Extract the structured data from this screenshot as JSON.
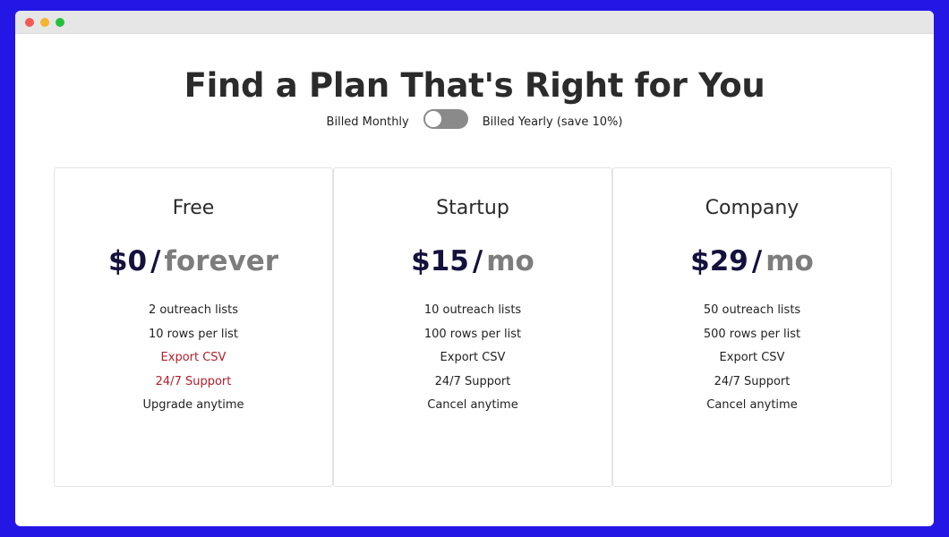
{
  "colors": {
    "background": "#2417e6",
    "window_dot_red": "#f25a55",
    "window_dot_yellow": "#f6b42b",
    "window_dot_green": "#26c03c",
    "price_amount": "#14113d",
    "price_period": "#7d7d7d",
    "unavailable_feature": "#b31d2a",
    "toggle_track": "#8a8a8a"
  },
  "heading": "Find a Plan That's Right for You",
  "billing": {
    "monthly_label": "Billed Monthly",
    "yearly_label": "Billed Yearly (save 10%)",
    "toggle_on": false
  },
  "plans": [
    {
      "name": "Free",
      "amount": "$0",
      "slash": "/",
      "period": "forever",
      "features": [
        {
          "text": "2 outreach lists",
          "available": true
        },
        {
          "text": "10 rows per list",
          "available": true
        },
        {
          "text": "Export CSV",
          "available": false
        },
        {
          "text": "24/7 Support",
          "available": false
        },
        {
          "text": "Upgrade anytime",
          "available": true
        }
      ]
    },
    {
      "name": "Startup",
      "amount": "$15",
      "slash": "/",
      "period": "mo",
      "features": [
        {
          "text": "10 outreach lists",
          "available": true
        },
        {
          "text": "100 rows per list",
          "available": true
        },
        {
          "text": "Export CSV",
          "available": true
        },
        {
          "text": "24/7 Support",
          "available": true
        },
        {
          "text": "Cancel anytime",
          "available": true
        }
      ]
    },
    {
      "name": "Company",
      "amount": "$29",
      "slash": "/",
      "period": "mo",
      "features": [
        {
          "text": "50 outreach lists",
          "available": true
        },
        {
          "text": "500 rows per list",
          "available": true
        },
        {
          "text": "Export CSV",
          "available": true
        },
        {
          "text": "24/7 Support",
          "available": true
        },
        {
          "text": "Cancel anytime",
          "available": true
        }
      ]
    }
  ]
}
